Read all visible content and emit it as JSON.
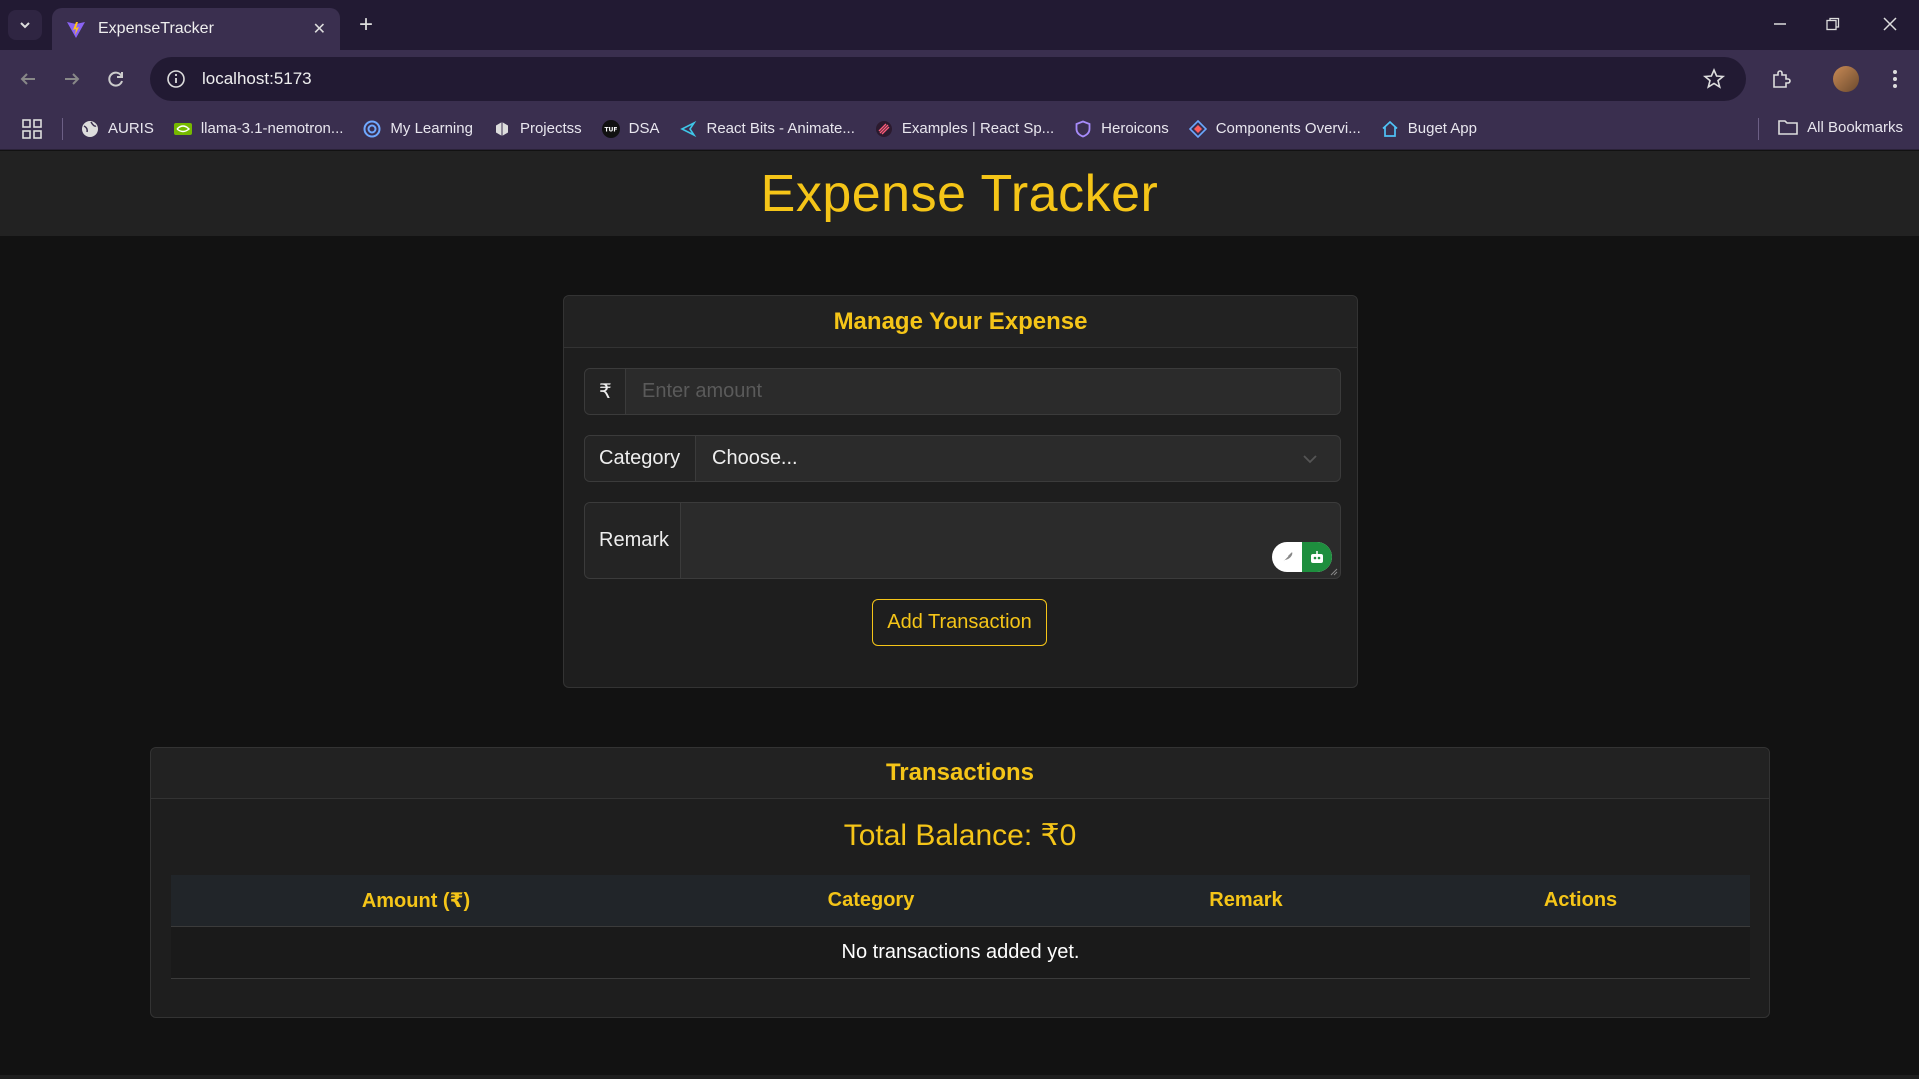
{
  "browser": {
    "tab_title": "ExpenseTracker",
    "url": "localhost:5173",
    "bookmarks": [
      {
        "label": "AURIS",
        "icon": "globe-icon"
      },
      {
        "label": "llama-3.1-nemotron...",
        "icon": "nvidia-icon"
      },
      {
        "label": "My Learning",
        "icon": "learning-icon"
      },
      {
        "label": "Projectss",
        "icon": "project-icon"
      },
      {
        "label": "DSA",
        "icon": "tuf-icon"
      },
      {
        "label": "React Bits - Animate...",
        "icon": "react-bits-icon"
      },
      {
        "label": "Examples | React Sp...",
        "icon": "react-spring-icon"
      },
      {
        "label": "Heroicons",
        "icon": "heroicons-icon"
      },
      {
        "label": "Components Overvi...",
        "icon": "components-icon"
      },
      {
        "label": "Buget App",
        "icon": "home-icon"
      }
    ],
    "all_bookmarks": "All Bookmarks"
  },
  "app": {
    "title": "Expense Tracker",
    "form": {
      "title": "Manage Your Expense",
      "currency_symbol": "₹",
      "amount_placeholder": "Enter amount",
      "category_label": "Category",
      "category_selected": "Choose...",
      "remark_label": "Remark",
      "submit_label": "Add Transaction"
    },
    "transactions": {
      "title": "Transactions",
      "balance_text": "Total Balance: ₹0",
      "columns": [
        "Amount (₹)",
        "Category",
        "Remark",
        "Actions"
      ],
      "empty_text": "No transactions added yet."
    }
  },
  "colors": {
    "accent": "#f5c518",
    "background": "#121212",
    "card": "#1e1e1e",
    "browser_frame": "#3a2f4f"
  }
}
